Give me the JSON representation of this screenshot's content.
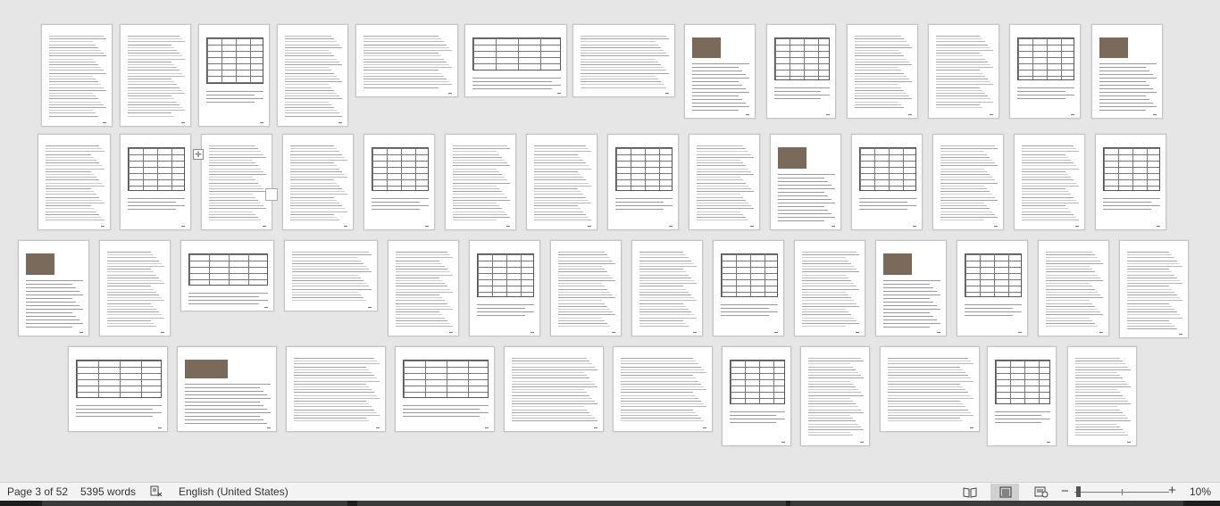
{
  "status_bar": {
    "page_indicator": "Page 3 of 52",
    "word_count": "5395 words",
    "proofing_icon": "proofing-error-icon",
    "language": "English (United States)",
    "views": [
      "read-mode-icon",
      "print-layout-icon",
      "web-layout-icon"
    ],
    "active_view": "print-layout-icon",
    "zoom_level": "10%",
    "zoom_minus": "−",
    "zoom_plus": "+"
  },
  "document": {
    "total_pages": 52,
    "current_page": 3
  },
  "colors": {
    "canvas": "#e6e6e6",
    "page": "#ffffff",
    "statusbar": "#f3f3f3",
    "taskbar": "#1e1e1e"
  }
}
